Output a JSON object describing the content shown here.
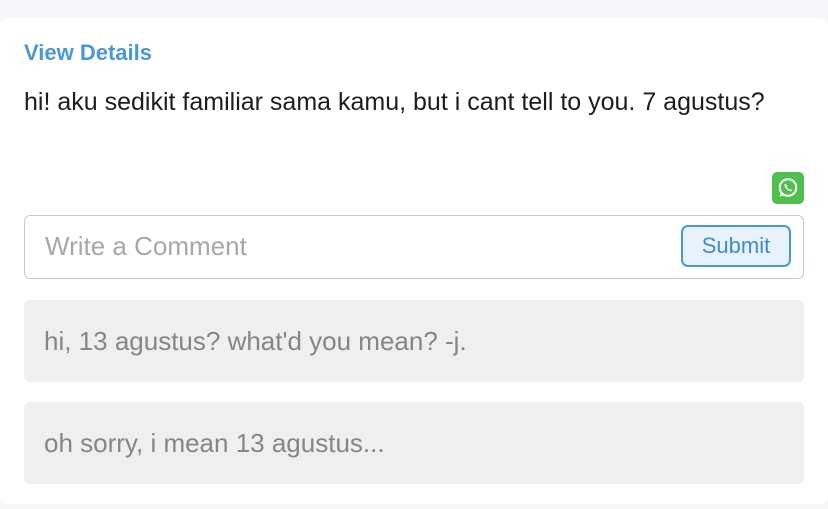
{
  "post": {
    "view_details_label": "View Details",
    "message": "hi! aku sedikit familiar sama kamu, but i cant tell to you. 7 agustus?",
    "share_icon": "whatsapp-icon"
  },
  "comment_form": {
    "placeholder": "Write a Comment",
    "value": "",
    "submit_label": "Submit"
  },
  "comments": [
    {
      "text": "hi, 13 agustus? what'd you mean? -j."
    },
    {
      "text": "oh sorry, i mean 13 agustus..."
    }
  ],
  "colors": {
    "link": "#4a97d4",
    "whatsapp": "#4fc04e",
    "comment_bg": "#efefef",
    "comment_text": "#85858a"
  }
}
